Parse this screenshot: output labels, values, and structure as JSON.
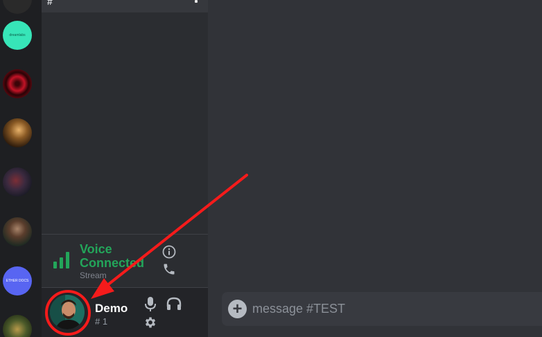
{
  "servers": [
    {
      "name": "server-partial-top",
      "label": ""
    },
    {
      "name": "server-dreamlabs",
      "label": "dreamlabs"
    },
    {
      "name": "server-red-mask",
      "label": ""
    },
    {
      "name": "server-portrait-gold",
      "label": ""
    },
    {
      "name": "server-portrait-dark",
      "label": ""
    },
    {
      "name": "server-portrait-woman",
      "label": ""
    },
    {
      "name": "server-blue",
      "label": "ETHER DOCS"
    },
    {
      "name": "server-partial-bottom",
      "label": ""
    }
  ],
  "channel_header": {
    "icon": "#"
  },
  "voice": {
    "status": "Voice Connected",
    "subtitle": "Stream",
    "status_color": "#23a55a"
  },
  "user": {
    "name": "Demo",
    "tag": "# 1"
  },
  "composer": {
    "placeholder": "message #TEST",
    "add_icon": "+"
  },
  "annotation": {
    "color": "#f51b1b",
    "shapes": [
      "arrow",
      "circle"
    ]
  }
}
